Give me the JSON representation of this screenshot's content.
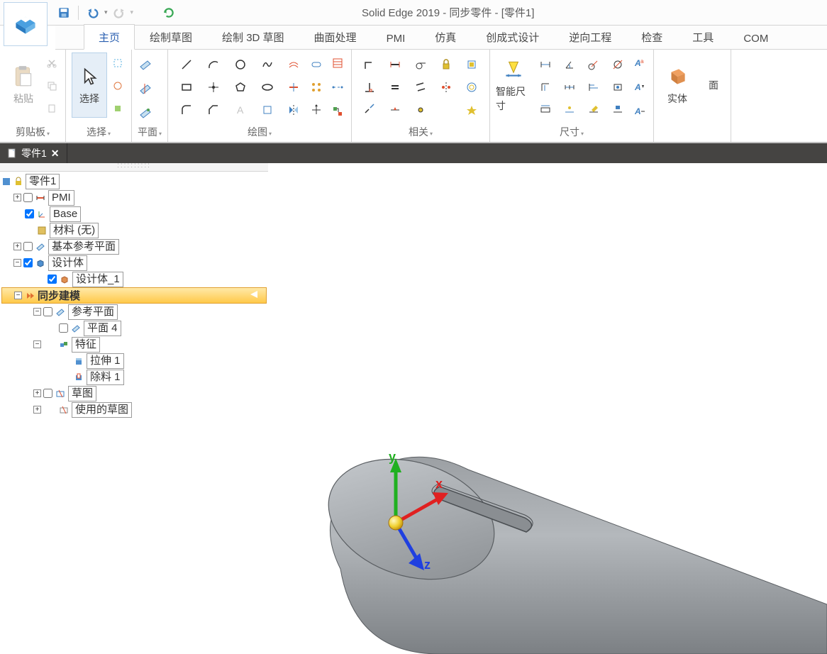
{
  "app": {
    "title": "Solid Edge 2019 - 同步零件 - [零件1]"
  },
  "qat": {
    "save": "保存",
    "undo": "撤销",
    "redo": "重做",
    "update": "更新"
  },
  "tabs": {
    "home": "主页",
    "sketch": "绘制草图",
    "sketch3d": "绘制 3D 草图",
    "surface": "曲面处理",
    "pmi": "PMI",
    "sim": "仿真",
    "generative": "创成式设计",
    "reverse": "逆向工程",
    "inspect": "检查",
    "tools": "工具",
    "com": "COM"
  },
  "groups": {
    "clipboard": {
      "label": "剪贴板",
      "paste": "粘贴"
    },
    "select": {
      "label": "选择",
      "btn": "选择"
    },
    "plane": {
      "label": "平面"
    },
    "draw": {
      "label": "绘图"
    },
    "relate": {
      "label": "相关"
    },
    "dim": {
      "label": "尺寸",
      "smart": "智能尺寸"
    },
    "solid": {
      "label": "",
      "btn": "实体"
    },
    "face": {
      "label": "面"
    }
  },
  "doc_tab": {
    "name": "零件1"
  },
  "tree": {
    "root": "零件1",
    "pmi": "PMI",
    "base": "Base",
    "material": "材料 (无)",
    "base_planes": "基本参考平面",
    "design_body": "设计体",
    "design_body_1": "设计体_1",
    "sync_model": "同步建模",
    "ref_planes": "参考平面",
    "plane4": "平面 4",
    "features": "特征",
    "extrude1": "拉伸 1",
    "cut1": "除料 1",
    "sketch": "草图",
    "used_sketch": "使用的草图"
  },
  "axes": {
    "x": "x",
    "y": "y",
    "z": "z"
  }
}
